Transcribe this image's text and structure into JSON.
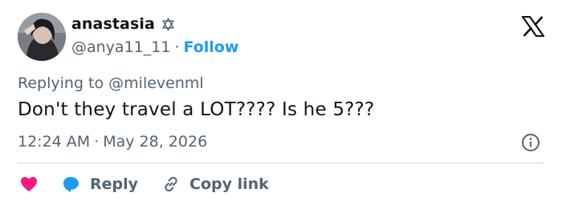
{
  "user": {
    "display_name": "anastasia",
    "handle": "@anya11_11",
    "separator": "·",
    "follow_label": "Follow",
    "badge_icon": "star-of-david-icon",
    "avatar_icon": "avatar"
  },
  "header": {
    "logo_icon": "x-logo-icon"
  },
  "tweet": {
    "reply_prefix": "Replying to ",
    "reply_to": "@milevenml",
    "text": "Don't they travel a LOT???? Is he 5???",
    "time": "12:24 AM",
    "separator": "·",
    "date": "May 28, 2026",
    "info_icon": "info-icon"
  },
  "actions": {
    "like_icon": "heart-icon",
    "reply_icon": "reply-bubble-icon",
    "reply_label": "Reply",
    "copy_icon": "link-icon",
    "copy_label": "Copy link"
  },
  "colors": {
    "accent": "#1d9bf0",
    "heart": "#f91880",
    "text_primary": "#0f1419",
    "text_secondary": "#536471",
    "divider": "#cfd9de"
  }
}
